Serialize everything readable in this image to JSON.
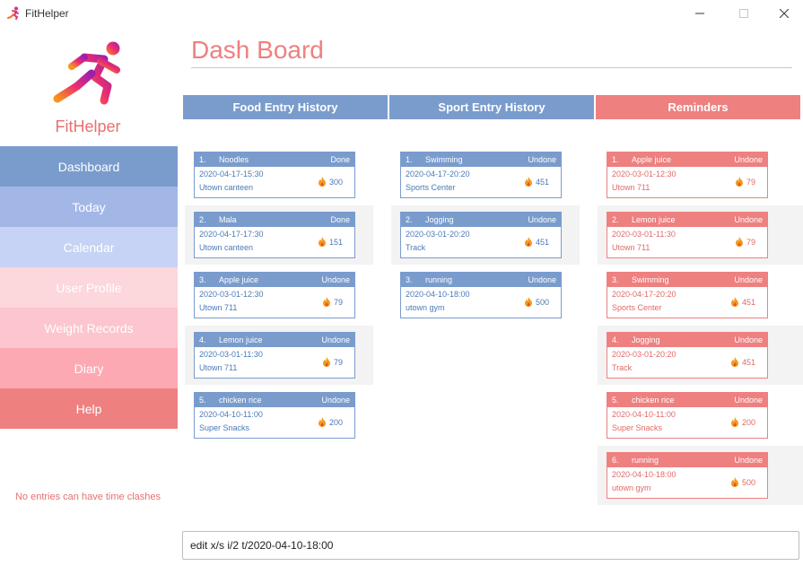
{
  "window": {
    "title": "FitHelper"
  },
  "sidebar": {
    "brand": "FitHelper",
    "items": [
      {
        "label": "Dashboard",
        "color": "#7a9ccd"
      },
      {
        "label": "Today",
        "color": "#a3b7e6"
      },
      {
        "label": "Calendar",
        "color": "#c6d3f4"
      },
      {
        "label": "User Profile",
        "color": "#fcd7dc"
      },
      {
        "label": "Weight Records",
        "color": "#fdc5cd"
      },
      {
        "label": "Diary",
        "color": "#fda9b4"
      },
      {
        "label": "Help",
        "color": "#ee8080"
      }
    ],
    "note": "No entries can have time clashes"
  },
  "main": {
    "title": "Dash Board",
    "columns": [
      {
        "header": "Food Entry History",
        "theme": "blue",
        "entries": [
          {
            "index": "1.",
            "name": "Noodles",
            "status": "Done",
            "time": "2020-04-17-15:30",
            "place": "Utown canteen",
            "calorie": "300"
          },
          {
            "index": "2.",
            "name": "Mala",
            "status": "Done",
            "time": "2020-04-17-17:30",
            "place": "Utown canteen",
            "calorie": "151"
          },
          {
            "index": "3.",
            "name": "Apple juice",
            "status": "Undone",
            "time": "2020-03-01-12:30",
            "place": "Utown 711",
            "calorie": "79"
          },
          {
            "index": "4.",
            "name": "Lemon juice",
            "status": "Undone",
            "time": "2020-03-01-11:30",
            "place": "Utown 711",
            "calorie": "79"
          },
          {
            "index": "5.",
            "name": "chicken rice",
            "status": "Undone",
            "time": "2020-04-10-11:00",
            "place": "Super Snacks",
            "calorie": "200"
          }
        ]
      },
      {
        "header": "Sport Entry History",
        "theme": "blue",
        "entries": [
          {
            "index": "1.",
            "name": "Swimming",
            "status": "Undone",
            "time": "2020-04-17-20:20",
            "place": "Sports Center",
            "calorie": "451"
          },
          {
            "index": "2.",
            "name": "Jogging",
            "status": "Undone",
            "time": "2020-03-01-20:20",
            "place": "Track",
            "calorie": "451"
          },
          {
            "index": "3.",
            "name": "running",
            "status": "Undone",
            "time": "2020-04-10-18:00",
            "place": "utown gym",
            "calorie": "500"
          }
        ]
      },
      {
        "header": "Reminders",
        "theme": "red",
        "entries": [
          {
            "index": "1.",
            "name": "Apple juice",
            "status": "Undone",
            "time": "2020-03-01-12:30",
            "place": "Utown 711",
            "calorie": "79"
          },
          {
            "index": "2.",
            "name": "Lemon juice",
            "status": "Undone",
            "time": "2020-03-01-11:30",
            "place": "Utown 711",
            "calorie": "79"
          },
          {
            "index": "3.",
            "name": "Swimming",
            "status": "Undone",
            "time": "2020-04-17-20:20",
            "place": "Sports Center",
            "calorie": "451"
          },
          {
            "index": "4.",
            "name": "Jogging",
            "status": "Undone",
            "time": "2020-03-01-20:20",
            "place": "Track",
            "calorie": "451"
          },
          {
            "index": "5.",
            "name": "chicken rice",
            "status": "Undone",
            "time": "2020-04-10-11:00",
            "place": "Super Snacks",
            "calorie": "200"
          },
          {
            "index": "6.",
            "name": "running",
            "status": "Undone",
            "time": "2020-04-10-18:00",
            "place": "utown gym",
            "calorie": "500"
          }
        ]
      }
    ],
    "colors": {
      "blue": "#7a9ccd",
      "red": "#ee8080"
    }
  },
  "command": {
    "value": "edit x/s i/2 t/2020-04-10-18:00"
  }
}
